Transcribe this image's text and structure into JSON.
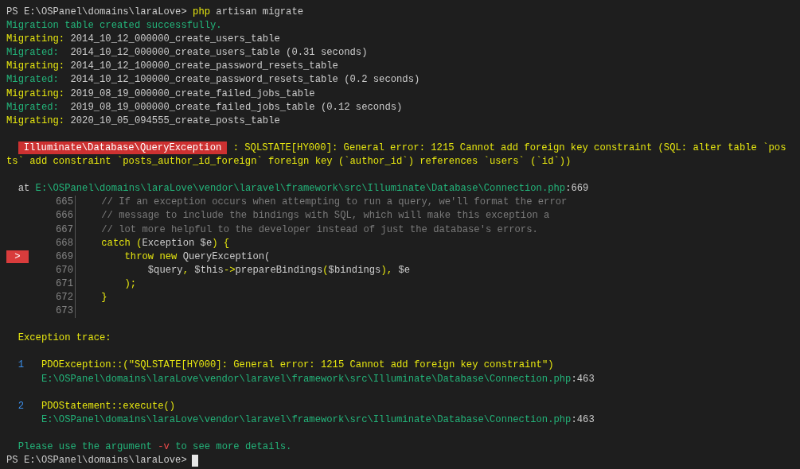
{
  "terminal": {
    "lines": [
      {
        "kind": "text",
        "spans": [
          {
            "kind": "prompt",
            "text": "PS E:\\OSPanel\\domains\\laraLove>"
          },
          {
            "kind": "command",
            "text": " php"
          },
          {
            "kind": "argument",
            "text": " artisan migrate"
          }
        ]
      },
      {
        "kind": "text",
        "spans": [
          {
            "kind": "success",
            "text": "Migration table created successfully."
          }
        ]
      },
      {
        "kind": "text",
        "spans": [
          {
            "kind": "migrating-label",
            "text": "Migrating:"
          },
          {
            "kind": "migration-name",
            "text": " 2014_10_12_000000_create_users_table"
          }
        ]
      },
      {
        "kind": "text",
        "spans": [
          {
            "kind": "migrated-label",
            "text": "Migrated:"
          },
          {
            "kind": "migration-name",
            "text": "  2014_10_12_000000_create_users_table (0.31 seconds)"
          }
        ]
      },
      {
        "kind": "text",
        "spans": [
          {
            "kind": "migrating-label",
            "text": "Migrating:"
          },
          {
            "kind": "migration-name",
            "text": " 2014_10_12_100000_create_password_resets_table"
          }
        ]
      },
      {
        "kind": "text",
        "spans": [
          {
            "kind": "migrated-label",
            "text": "Migrated:"
          },
          {
            "kind": "migration-name",
            "text": "  2014_10_12_100000_create_password_resets_table (0.2 seconds)"
          }
        ]
      },
      {
        "kind": "text",
        "spans": [
          {
            "kind": "migrating-label",
            "text": "Migrating:"
          },
          {
            "kind": "migration-name",
            "text": " 2019_08_19_000000_create_failed_jobs_table"
          }
        ]
      },
      {
        "kind": "text",
        "spans": [
          {
            "kind": "migrated-label",
            "text": "Migrated:"
          },
          {
            "kind": "migration-name",
            "text": "  2019_08_19_000000_create_failed_jobs_table (0.12 seconds)"
          }
        ]
      },
      {
        "kind": "text",
        "spans": [
          {
            "kind": "migrating-label",
            "text": "Migrating:"
          },
          {
            "kind": "migration-name",
            "text": " 2020_10_05_094555_create_posts_table"
          }
        ]
      },
      {
        "kind": "blank"
      },
      {
        "kind": "text",
        "spans": [
          {
            "kind": "error-badge",
            "text": "  Illuminate\\Database\\QueryException"
          },
          {
            "kind": "error-message",
            "text": " : SQLSTATE[HY000]: General error: 1215 Cannot add foreign key constraint (SQL: alter table `pos"
          }
        ]
      },
      {
        "kind": "text",
        "spans": [
          {
            "kind": "error-message",
            "text": "ts` add constraint `posts_author_id_foreign` foreign key (`author_id`) references `users` (`id`))"
          }
        ]
      },
      {
        "kind": "blank"
      },
      {
        "kind": "text",
        "spans": [
          {
            "kind": "location-label",
            "text": "  at"
          },
          {
            "kind": "file-path",
            "text": " E:\\OSPanel\\domains\\laraLove\\vendor\\laravel\\framework\\src\\Illuminate\\Database\\Connection.php"
          },
          {
            "kind": "line-ref",
            "text": ":669"
          }
        ]
      },
      {
        "kind": "code",
        "number": "665",
        "current": false,
        "spans": [
          {
            "kind": "comment",
            "text": "    // If an exception occurs when attempting to run a query, we'll format the error"
          }
        ]
      },
      {
        "kind": "code",
        "number": "666",
        "current": false,
        "spans": [
          {
            "kind": "comment",
            "text": "    // message to include the bindings with SQL, which will make this exception a"
          }
        ]
      },
      {
        "kind": "code",
        "number": "667",
        "current": false,
        "spans": [
          {
            "kind": "comment",
            "text": "    // lot more helpful to the developer instead of just the database's errors."
          }
        ]
      },
      {
        "kind": "code",
        "number": "668",
        "current": false,
        "spans": [
          {
            "kind": "code-keyword",
            "text": "    catch ("
          },
          {
            "kind": "code-text",
            "text": "Exception $e"
          },
          {
            "kind": "code-keyword",
            "text": ") {"
          }
        ]
      },
      {
        "kind": "code",
        "number": "669",
        "current": true,
        "marker": ">",
        "spans": [
          {
            "kind": "code-keyword",
            "text": "        throw new"
          },
          {
            "kind": "code-text",
            "text": " QueryException("
          }
        ]
      },
      {
        "kind": "code",
        "number": "670",
        "current": false,
        "spans": [
          {
            "kind": "code-text",
            "text": "            $query"
          },
          {
            "kind": "code-keyword",
            "text": ","
          },
          {
            "kind": "code-text",
            "text": " $this"
          },
          {
            "kind": "code-keyword",
            "text": "->"
          },
          {
            "kind": "code-text",
            "text": "prepareBindings"
          },
          {
            "kind": "code-keyword",
            "text": "("
          },
          {
            "kind": "code-text",
            "text": "$bindings"
          },
          {
            "kind": "code-keyword",
            "text": "),"
          },
          {
            "kind": "code-text",
            "text": " $e"
          }
        ]
      },
      {
        "kind": "code",
        "number": "671",
        "current": false,
        "spans": [
          {
            "kind": "code-keyword",
            "text": "        );"
          }
        ]
      },
      {
        "kind": "code",
        "number": "672",
        "current": false,
        "spans": [
          {
            "kind": "code-keyword",
            "text": "    }"
          }
        ]
      },
      {
        "kind": "code",
        "number": "673",
        "current": false
      },
      {
        "kind": "blank"
      },
      {
        "kind": "text",
        "spans": [
          {
            "kind": "heading",
            "text": "  Exception trace:"
          }
        ]
      },
      {
        "kind": "blank"
      },
      {
        "kind": "text",
        "spans": [
          {
            "kind": "trace-index",
            "text": "  1"
          },
          {
            "kind": "trace-call",
            "text": "   PDOException::(\"SQLSTATE[HY000]: General error: 1215 Cannot add foreign key constraint\")"
          }
        ]
      },
      {
        "kind": "text",
        "spans": [
          {
            "kind": "file-path",
            "text": "      E:\\OSPanel\\domains\\laraLove\\vendor\\laravel\\framework\\src\\Illuminate\\Database\\Connection.php"
          },
          {
            "kind": "line-ref",
            "text": ":463"
          }
        ]
      },
      {
        "kind": "blank"
      },
      {
        "kind": "text",
        "spans": [
          {
            "kind": "trace-index",
            "text": "  2"
          },
          {
            "kind": "trace-call",
            "text": "   PDOStatement::execute()"
          }
        ]
      },
      {
        "kind": "text",
        "spans": [
          {
            "kind": "file-path",
            "text": "      E:\\OSPanel\\domains\\laraLove\\vendor\\laravel\\framework\\src\\Illuminate\\Database\\Connection.php"
          },
          {
            "kind": "line-ref",
            "text": ":463"
          }
        ]
      },
      {
        "kind": "blank"
      },
      {
        "kind": "text",
        "spans": [
          {
            "kind": "hint",
            "text": "  Please use the argument"
          },
          {
            "kind": "flag",
            "text": " -v"
          },
          {
            "kind": "hint",
            "text": " to see more details."
          }
        ]
      },
      {
        "kind": "text",
        "cursor": true,
        "spans": [
          {
            "kind": "prompt",
            "text": "PS E:\\OSPanel\\domains\\laraLove>"
          }
        ]
      }
    ]
  }
}
